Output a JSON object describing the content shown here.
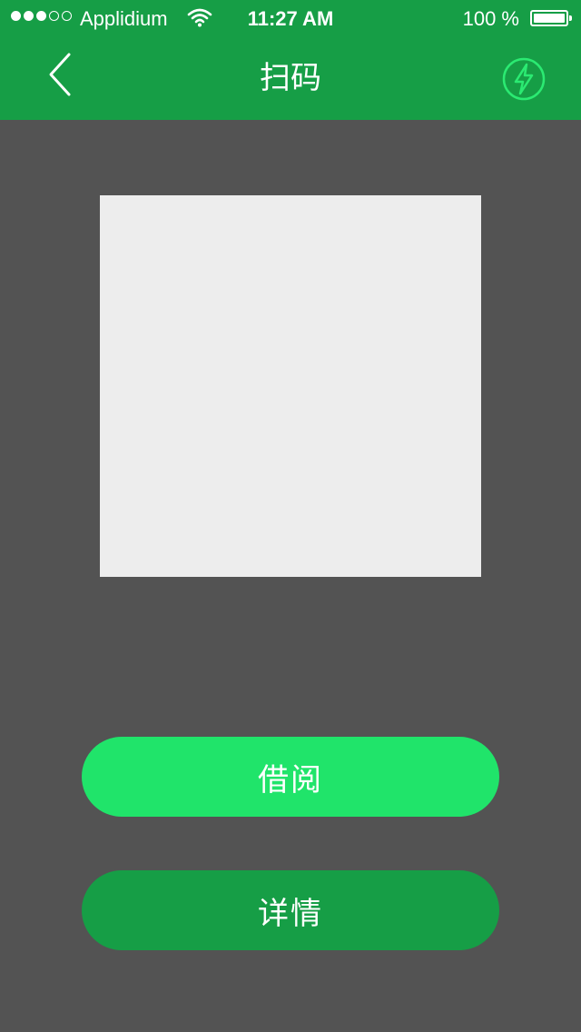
{
  "status_bar": {
    "carrier": "Applidium",
    "time": "11:27 AM",
    "battery": "100 %"
  },
  "nav": {
    "title": "扫码",
    "back_icon": "chevron-left-icon",
    "flash_icon": "flash-icon"
  },
  "actions": {
    "borrow_label": "借阅",
    "detail_label": "详情"
  },
  "colors": {
    "header": "#169e46",
    "background": "#535353",
    "scan_area": "#ededed",
    "primary_button": "#20e46a",
    "secondary_button": "#169e46"
  }
}
